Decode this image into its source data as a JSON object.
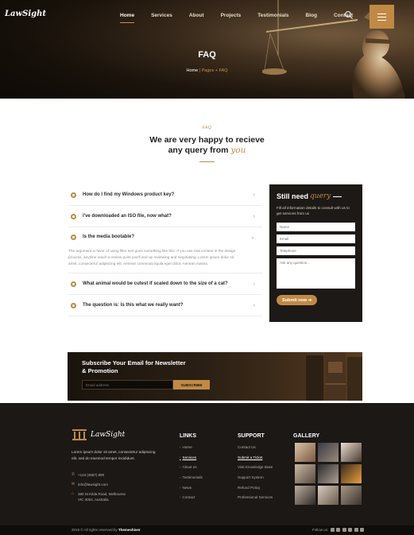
{
  "brand": {
    "name": "LawSight"
  },
  "nav": [
    {
      "label": "Home",
      "active": true
    },
    {
      "label": "Services"
    },
    {
      "label": "About"
    },
    {
      "label": "Projects"
    },
    {
      "label": "Testimonials"
    },
    {
      "label": "Blog"
    },
    {
      "label": "Contact"
    }
  ],
  "hero": {
    "title": "FAQ",
    "breadcrumb": {
      "home": "Home",
      "sep": "|",
      "current": "Pages + FAQ"
    }
  },
  "faq": {
    "kicker": "FAQ",
    "heading_line1": "We are very happy to recieve",
    "heading_line2_pre": "any query from",
    "heading_line2_accent": "you",
    "items": [
      {
        "question": "How do I find my Windows product key?",
        "open": false
      },
      {
        "question": "I've downloaded an ISO file, now what?",
        "open": false
      },
      {
        "question": "Is the media bootable?",
        "open": true,
        "answer": "The argument in favor of using filler text goes something like this: If you use real content in the design process, anytime reach a review point you'll end up reviewing and negotiating. Lorem ipsum dolor sit amet, consectetur adipiscing elit. Aenean commodo ligula eget dolor. Aenean massa."
      },
      {
        "question": "What animal would be cutest if scaled down to the size of a cat?",
        "open": false
      },
      {
        "question": "The question is: Is this what we really want?",
        "open": false
      }
    ]
  },
  "query_form": {
    "title_pre": "Still need",
    "title_accent": "query",
    "description": "Fill all information details to consult with us to get services from us",
    "name_placeholder": "Name",
    "email_placeholder": "Email",
    "phone_placeholder": "Telephone",
    "message_placeholder": "Ask any question...",
    "submit_label": "Submit now ➔"
  },
  "newsletter": {
    "title_line1": "Subscribe Your Email for Newsletter",
    "title_line2": "& Promotion",
    "email_placeholder": "Email address",
    "button_label": "SUBSCRIBE"
  },
  "footer": {
    "brand": "LawSight",
    "about": "Lorem ipsum dolor sit amet, consectetur adipiscing elit, sed do eiusmod tempor incididunt.",
    "phone": "+123 (4567) 890",
    "email": "info@lawsight.com",
    "address_line1": "380 St Kilda Road, Melbourne",
    "address_line2": "VIC 3004, Australia",
    "links_title": "LINKS",
    "links": [
      "Home",
      "Services",
      "About us",
      "Testimonials",
      "News",
      "Contact"
    ],
    "support_title": "SUPPORT",
    "support": [
      "Contact Us",
      "Submit a Ticket",
      "Visit Knowledge Base",
      "Support System",
      "Refund Policy",
      "Professional Services"
    ],
    "gallery_title": "GALLERY",
    "copyright_pre": "2019 © All rights reserved by",
    "copyright_brand": "Themeshiver",
    "follow_label": "Follow us:"
  },
  "colors": {
    "accent": "#c08a45",
    "dark": "#1b1816"
  },
  "icons": [
    "search-icon",
    "menu-icon",
    "scales-icon",
    "phone-icon",
    "mail-icon",
    "location-icon",
    "chevron-right-icon",
    "chevron-down-icon"
  ]
}
